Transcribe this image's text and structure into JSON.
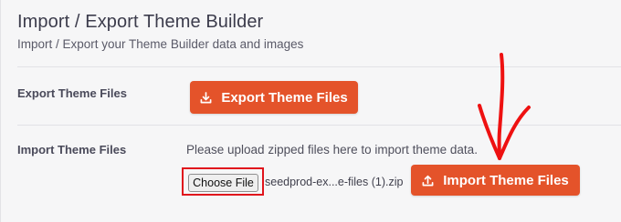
{
  "header": {
    "title": "Import / Export Theme Builder",
    "subtitle": "Import / Export your Theme Builder data and images"
  },
  "export_row": {
    "label": "Export Theme Files",
    "button_label": "Export Theme Files",
    "button_icon": "download-icon"
  },
  "import_row": {
    "label": "Import Theme Files",
    "hint": "Please upload zipped files here to import theme data.",
    "choose_file_label": "Choose File",
    "selected_file": "seedprod-ex...e-files (1).zip",
    "button_label": "Import Theme Files",
    "button_icon": "upload-icon"
  },
  "colors": {
    "accent": "#e4532a",
    "annotation": "#e0141c",
    "background": "#f6f6f7"
  },
  "annotation": {
    "arrow_icon": "hand-drawn-down-arrow-icon",
    "highlight": "choose-file-highlight"
  }
}
